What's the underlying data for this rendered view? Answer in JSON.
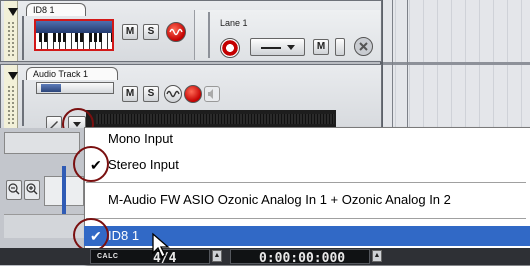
{
  "tracks": [
    {
      "name": "ID8 1",
      "buttons": {
        "mute": "M",
        "solo": "S"
      },
      "lane": {
        "name": "Lane 1",
        "buttons": {
          "mute": "M"
        }
      }
    },
    {
      "name": "Audio Track 1",
      "buttons": {
        "mute": "M",
        "solo": "S"
      }
    }
  ],
  "input_menu": {
    "items": [
      {
        "label": "Mono Input",
        "checked": false,
        "highlighted": false
      },
      {
        "label": "Stereo Input",
        "checked": true,
        "highlighted": false
      },
      {
        "label": "M-Audio FW ASIO Ozonic Analog In 1 + Ozonic Analog In 2",
        "checked": false,
        "highlighted": false
      },
      {
        "label": "ID8 1",
        "checked": true,
        "highlighted": true
      }
    ],
    "check_glyph": "✔"
  },
  "transport": {
    "calc_label": "CALC",
    "time_signature": "4/4",
    "position": "0:00:00:000"
  },
  "colors": {
    "menu_highlight": "#3169c6",
    "annotation_circle": "#7a1010",
    "record_red": "#c40000",
    "instrument_selection_border": "#d21818"
  },
  "icons": {
    "collapse": "triangle-down-icon",
    "record": "record-icon",
    "monitor": "monitor-wave-icon",
    "input": "input-dropdown-icon",
    "zoom_out": "zoom-out-icon",
    "zoom_in": "zoom-in-icon",
    "cursor": "mouse-pointer-icon"
  }
}
